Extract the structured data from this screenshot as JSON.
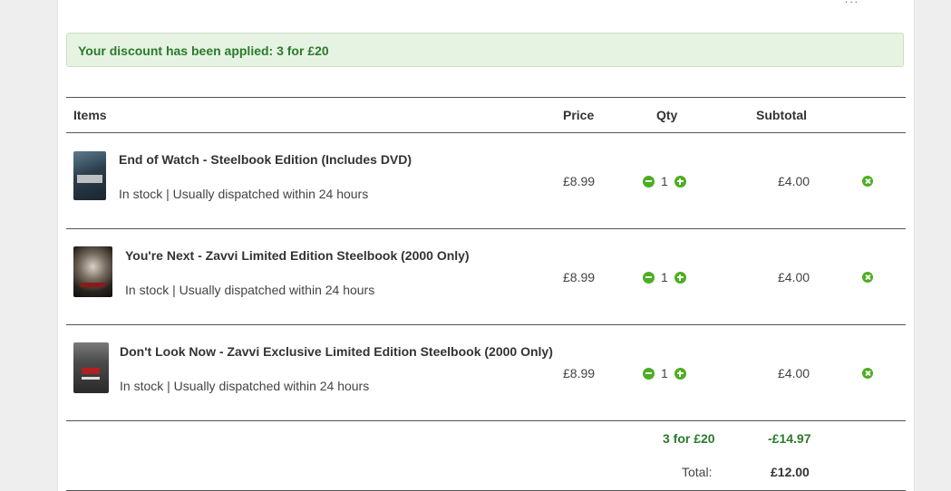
{
  "top_fragment": "...",
  "alert": {
    "message": "Your discount has been applied: 3 for £20"
  },
  "table": {
    "headers": {
      "items": "Items",
      "price": "Price",
      "qty": "Qty",
      "subtotal": "Subtotal"
    },
    "rows": [
      {
        "title": "End of Watch - Steelbook Edition (Includes DVD)",
        "stock": "In stock | Usually dispatched within 24 hours",
        "price": "£8.99",
        "qty": "1",
        "subtotal": "£4.00"
      },
      {
        "title": "You're Next - Zavvi Limited Edition Steelbook (2000 Only)",
        "stock": "In stock | Usually dispatched within 24 hours",
        "price": "£8.99",
        "qty": "1",
        "subtotal": "£4.00"
      },
      {
        "title": "Don't Look Now - Zavvi Exclusive Limited Edition Steelbook (2000 Only)",
        "stock": "In stock | Usually dispatched within 24 hours",
        "price": "£8.99",
        "qty": "1",
        "subtotal": "£4.00"
      }
    ]
  },
  "summary": {
    "discount_label": "3 for £20",
    "discount_value": "-£14.97",
    "total_label": "Total:",
    "total_value": "£12.00"
  },
  "colors": {
    "accent": "#4cae22",
    "discount_text": "#2b7a2b",
    "alert_bg": "#e6f3e3"
  }
}
